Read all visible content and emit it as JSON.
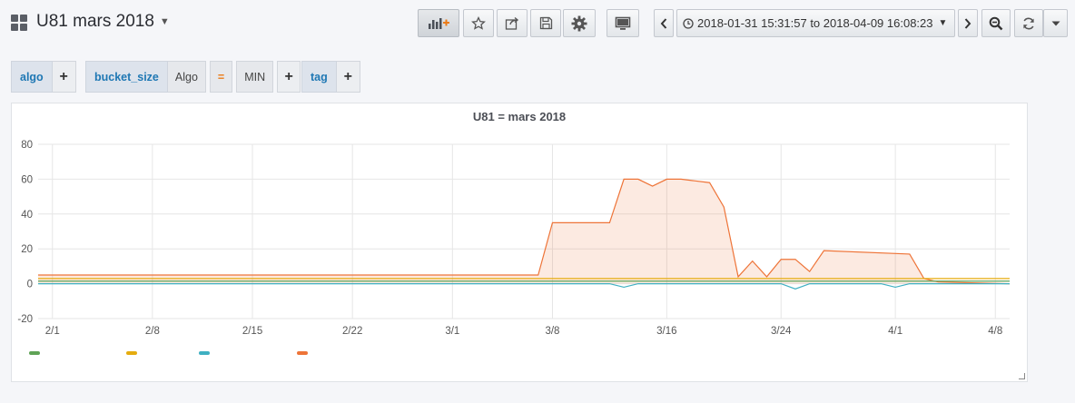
{
  "dashboard": {
    "title": "U81 mars 2018"
  },
  "toolbar": {
    "time_range": "2018-01-31 15:31:57 to 2018-04-09 16:08:23"
  },
  "variables": [
    {
      "label": "algo"
    },
    {
      "label": "bucket_size",
      "value": "Algo",
      "operator": "=",
      "value2": "MIN"
    },
    {
      "label": "tag"
    }
  ],
  "plus_symbol": "+",
  "panel": {
    "title": "U81 = mars 2018"
  },
  "chart_data": {
    "type": "line",
    "title": "U81 = mars 2018",
    "x_type": "date",
    "xlim": [
      "2018-01-31",
      "2018-04-09"
    ],
    "ylim": [
      -20,
      80
    ],
    "y_ticks": [
      "80",
      "60",
      "40",
      "20",
      "0",
      "-20"
    ],
    "x_ticks": [
      "2/1",
      "2/8",
      "2/15",
      "2/22",
      "3/1",
      "3/8",
      "3/16",
      "3/24",
      "4/1",
      "4/8"
    ],
    "x_tick_dates": [
      "2018-02-01",
      "2018-02-08",
      "2018-02-15",
      "2018-02-22",
      "2018-03-01",
      "2018-03-08",
      "2018-03-16",
      "2018-03-24",
      "2018-04-01",
      "2018-04-08"
    ],
    "grid": true,
    "legend_placement": "bottom-left",
    "series": [
      {
        "color": "#ee7438",
        "fill": true,
        "points": [
          [
            "2018-01-31",
            5
          ],
          [
            "2018-03-07",
            5
          ],
          [
            "2018-03-08",
            35
          ],
          [
            "2018-03-12",
            35
          ],
          [
            "2018-03-13",
            60
          ],
          [
            "2018-03-14",
            60
          ],
          [
            "2018-03-15",
            56
          ],
          [
            "2018-03-16",
            60
          ],
          [
            "2018-03-17",
            60
          ],
          [
            "2018-03-18",
            59
          ],
          [
            "2018-03-19",
            58
          ],
          [
            "2018-03-20",
            44
          ],
          [
            "2018-03-21",
            4
          ],
          [
            "2018-03-22",
            13
          ],
          [
            "2018-03-23",
            4
          ],
          [
            "2018-03-24",
            14
          ],
          [
            "2018-03-25",
            14
          ],
          [
            "2018-03-26",
            7
          ],
          [
            "2018-03-27",
            19
          ],
          [
            "2018-04-02",
            17
          ],
          [
            "2018-04-03",
            3
          ],
          [
            "2018-04-04",
            1
          ],
          [
            "2018-04-09",
            0
          ]
        ]
      },
      {
        "color": "#e5ac0e",
        "fill": false,
        "points": [
          [
            "2018-01-31",
            3
          ],
          [
            "2018-04-09",
            3
          ]
        ]
      },
      {
        "color": "#5fa356",
        "fill": false,
        "points": [
          [
            "2018-01-31",
            1.5
          ],
          [
            "2018-04-09",
            1.5
          ]
        ]
      },
      {
        "color": "#3fb0c2",
        "fill": false,
        "points": [
          [
            "2018-01-31",
            0
          ],
          [
            "2018-03-12",
            0
          ],
          [
            "2018-03-13",
            -2
          ],
          [
            "2018-03-14",
            0
          ],
          [
            "2018-03-16",
            0
          ],
          [
            "2018-03-24",
            0
          ],
          [
            "2018-03-25",
            -3
          ],
          [
            "2018-03-26",
            0
          ],
          [
            "2018-03-31",
            0
          ],
          [
            "2018-04-01",
            -2
          ],
          [
            "2018-04-02",
            0
          ],
          [
            "2018-04-09",
            0
          ]
        ]
      }
    ],
    "legend": [
      {
        "color": "#5fa356"
      },
      {
        "color": "#e5ac0e"
      },
      {
        "color": "#3fb0c2"
      },
      {
        "color": "#ee7438"
      }
    ]
  }
}
